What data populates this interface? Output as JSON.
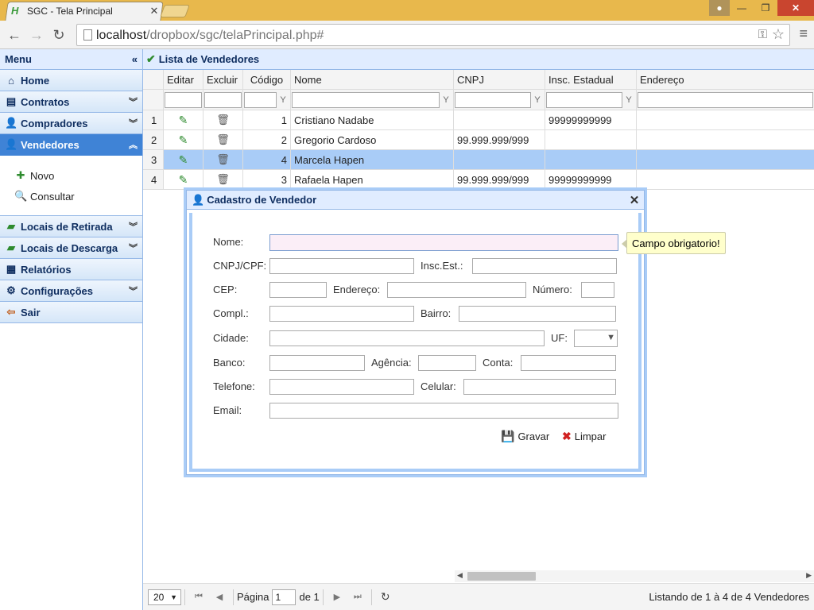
{
  "browser": {
    "tab_title": "SGC - Tela Principal",
    "url_host": "localhost",
    "url_path": "/dropbox/sgc/telaPrincipal.php#"
  },
  "sidebar": {
    "title": "Menu",
    "items": [
      {
        "label": "Home",
        "icon": "home-icon"
      },
      {
        "label": "Contratos",
        "icon": "contract-icon"
      },
      {
        "label": "Compradores",
        "icon": "user-icon"
      },
      {
        "label": "Vendedores",
        "icon": "user-icon",
        "active": true
      },
      {
        "label": "Locais de Retirada",
        "icon": "truck-icon"
      },
      {
        "label": "Locais de Descarga",
        "icon": "truck-icon"
      },
      {
        "label": "Relatórios",
        "icon": "report-icon"
      },
      {
        "label": "Configurações",
        "icon": "gear-icon"
      },
      {
        "label": "Sair",
        "icon": "exit-icon"
      }
    ],
    "vendedores_sub": [
      {
        "label": "Novo",
        "icon": "add-icon"
      },
      {
        "label": "Consultar",
        "icon": "search-icon"
      }
    ]
  },
  "panel": {
    "title": "Lista de Vendedores"
  },
  "grid": {
    "columns": [
      "Editar",
      "Excluir",
      "Código",
      "Nome",
      "CNPJ",
      "Insc. Estadual",
      "Endereço"
    ],
    "rows": [
      {
        "n": "1",
        "codigo": "1",
        "nome": "Cristiano Nadabe",
        "cnpj": "",
        "ie": "99999999999",
        "endereco": ""
      },
      {
        "n": "2",
        "codigo": "2",
        "nome": "Gregorio Cardoso",
        "cnpj": "99.999.999/999",
        "ie": "",
        "endereco": ""
      },
      {
        "n": "3",
        "codigo": "4",
        "nome": "Marcela Hapen",
        "cnpj": "",
        "ie": "",
        "endereco": "",
        "selected": true
      },
      {
        "n": "4",
        "codigo": "3",
        "nome": "Rafaela Hapen",
        "cnpj": "99.999.999/999",
        "ie": "99999999999",
        "endereco": ""
      }
    ]
  },
  "pager": {
    "page_size": "20",
    "page_label": "Página",
    "page_value": "1",
    "of_label": "de 1",
    "info": "Listando de 1 à 4 de 4 Vendedores"
  },
  "dialog": {
    "title": "Cadastro de Vendedor",
    "labels": {
      "nome": "Nome:",
      "cnpj": "CNPJ/CPF:",
      "ie": "Insc.Est.:",
      "cep": "CEP:",
      "endereco": "Endereço:",
      "numero": "Número:",
      "compl": "Compl.:",
      "bairro": "Bairro:",
      "cidade": "Cidade:",
      "uf": "UF:",
      "banco": "Banco:",
      "agencia": "Agência:",
      "conta": "Conta:",
      "telefone": "Telefone:",
      "celular": "Celular:",
      "email": "Email:"
    },
    "save_label": "Gravar",
    "clear_label": "Limpar",
    "tooltip": "Campo obrigatorio!"
  },
  "colors": {
    "accent": "#3f83d6",
    "header_bg": "#e0ecff",
    "selected_row": "#a9ccf7",
    "tab_bar": "#e8b84c"
  }
}
